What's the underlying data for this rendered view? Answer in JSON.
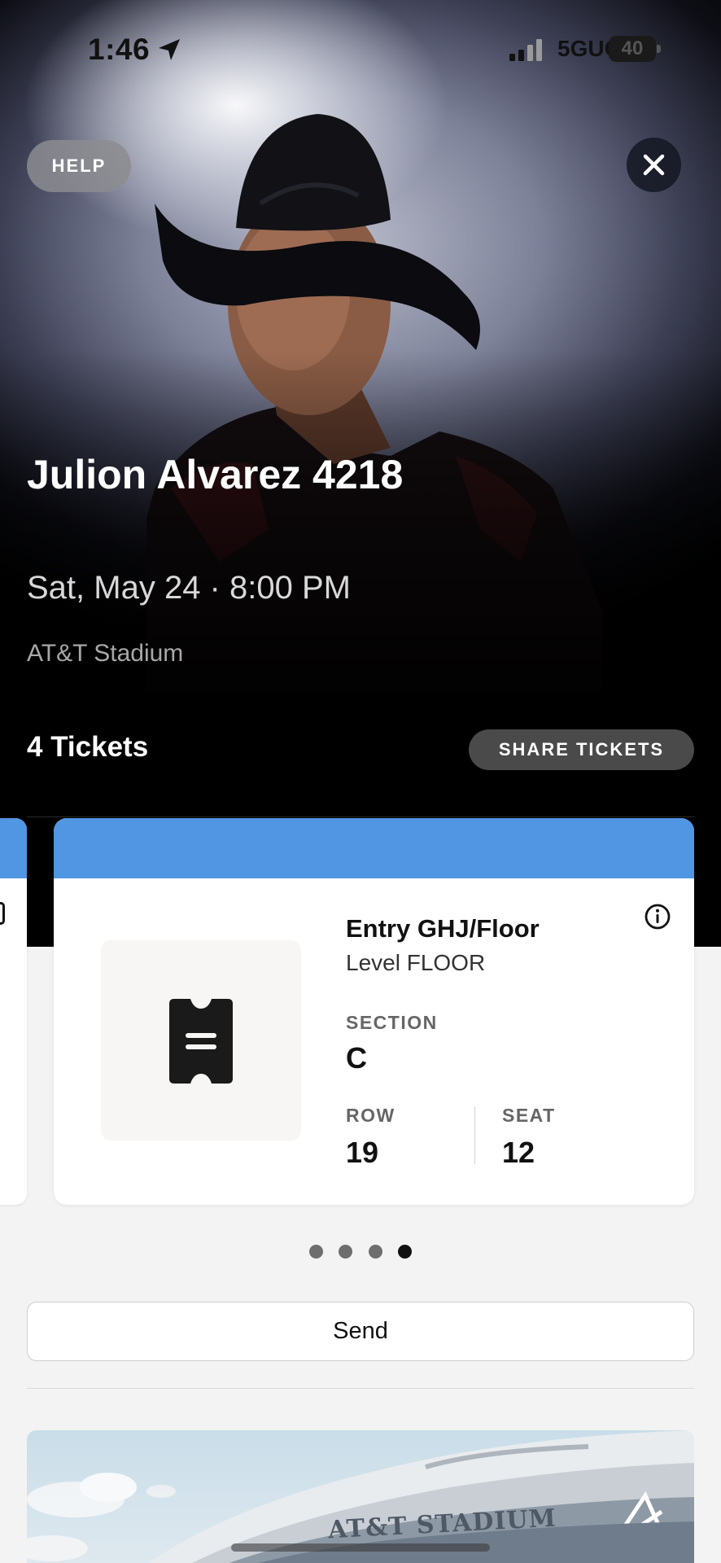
{
  "status_bar": {
    "time": "1:46",
    "network": "5GUC",
    "battery": "40"
  },
  "header": {
    "help_label": "HELP",
    "close_icon": "close-icon"
  },
  "event": {
    "title": "Julion Alvarez 4218",
    "date": "Sat, May 24 · 8:00 PM",
    "venue": "AT&T Stadium"
  },
  "tickets": {
    "count_label": "4 Tickets",
    "share_label": "SHARE TICKETS",
    "total": 4,
    "active_index": 4
  },
  "ticket_card": {
    "band_color": "#5096e2",
    "entry": "Entry GHJ/Floor",
    "level": "Level FLOOR",
    "section_label": "SECTION",
    "section_value": "C",
    "row_label": "ROW",
    "row_value": "19",
    "seat_label": "SEAT",
    "seat_value": "12",
    "thumb_icon": "ticket-icon",
    "info_icon": "info-icon"
  },
  "actions": {
    "send_label": "Send"
  },
  "venue_image": {
    "sign_text": "AT&T STADIUM"
  }
}
